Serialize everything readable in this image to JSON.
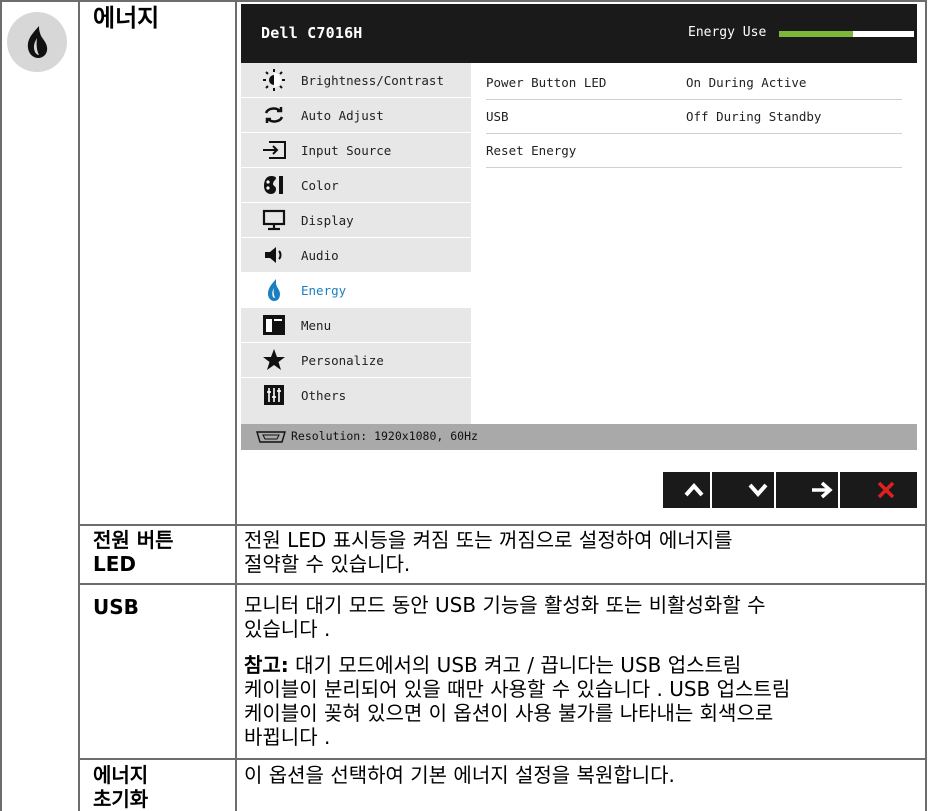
{
  "section_title": "에너지",
  "osd": {
    "model": "Dell C7016H",
    "energy_use_label": "Energy Use",
    "energy_use_level": 0.55,
    "menu": [
      {
        "label": "Brightness/Contrast",
        "icon": "brightness-icon"
      },
      {
        "label": "Auto Adjust",
        "icon": "auto-adjust-icon"
      },
      {
        "label": "Input Source",
        "icon": "input-source-icon"
      },
      {
        "label": "Color",
        "icon": "color-palette-icon"
      },
      {
        "label": "Display",
        "icon": "display-icon"
      },
      {
        "label": "Audio",
        "icon": "speaker-icon"
      },
      {
        "label": "Energy",
        "icon": "flame-icon"
      },
      {
        "label": "Menu",
        "icon": "menu-icon"
      },
      {
        "label": "Personalize",
        "icon": "star-icon"
      },
      {
        "label": "Others",
        "icon": "sliders-icon"
      }
    ],
    "active_item": "Energy",
    "options": [
      {
        "label": "Power Button LED",
        "value": "On During Active"
      },
      {
        "label": "USB",
        "value": "Off During Standby"
      },
      {
        "label": "Reset Energy",
        "value": ""
      }
    ],
    "resolution": "Resolution: 1920x1080, 60Hz",
    "accent_color": "#1a7fc0",
    "energy_bar_color": "#7bb83a",
    "close_color": "#e02020"
  },
  "rows": [
    {
      "label": "전원 버튼\nLED",
      "desc": "전원 LED 표시등을 켜짐 또는 꺼짐으로 설정하여 에너지를\n절약할 수 있습니다."
    },
    {
      "label": "USB",
      "desc": "모니터 대기 모드 동안 USB 기능을 활성화 또는 비활성화할 수\n있습니다 .",
      "note_label": "참고:",
      "note": "대기 모드에서의 USB 켜고 / 끕니다는 USB 업스트림\n케이블이 분리되어 있을 때만 사용할 수 있습니다 . USB 업스트림\n케이블이 꽂혀 있으면 이 옵션이 사용 불가를 나타내는 회색으로\n바뀝니다 ."
    },
    {
      "label": "에너지\n초기화",
      "desc": "이 옵션을 선택하여 기본 에너지 설정을 복원합니다."
    }
  ]
}
